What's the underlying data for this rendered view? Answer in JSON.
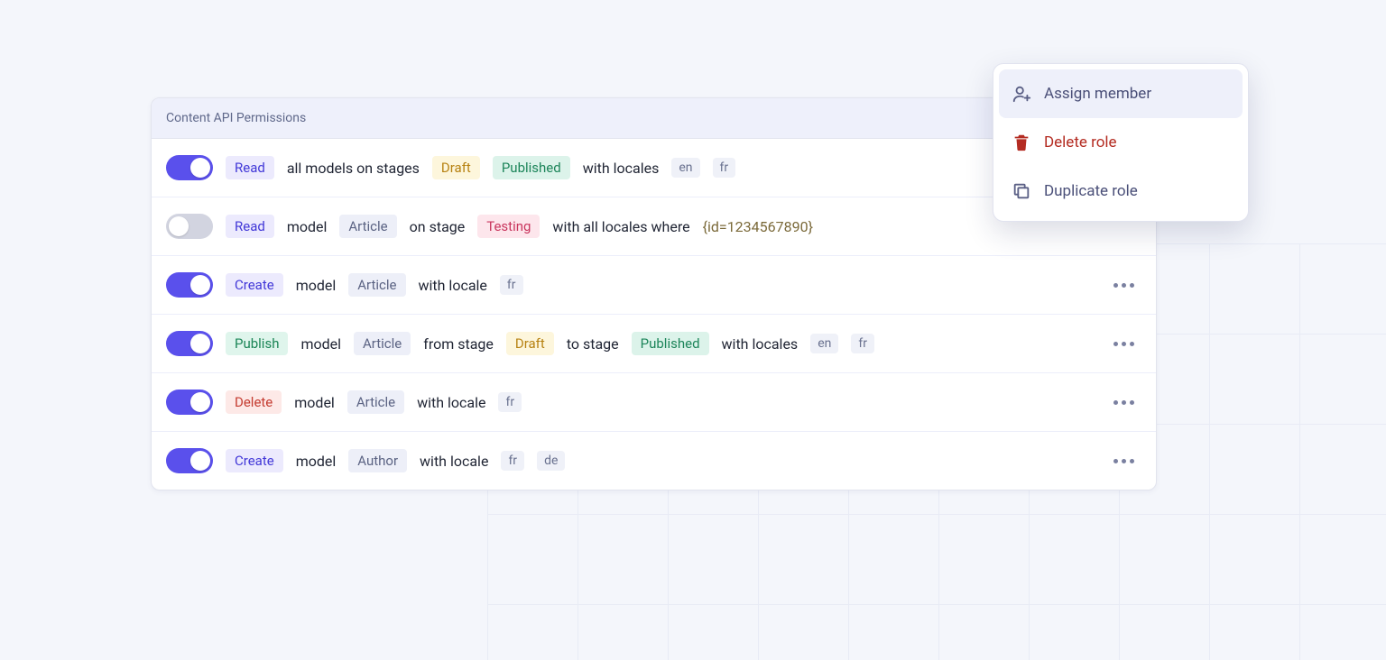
{
  "panel": {
    "title": "Content API Permissions"
  },
  "menu": {
    "items": [
      {
        "label": "Assign member",
        "kind": "assign"
      },
      {
        "label": "Delete role",
        "kind": "delete"
      },
      {
        "label": "Duplicate role",
        "kind": "duplicate"
      }
    ]
  },
  "rows": [
    {
      "enabled": true,
      "has_menu": false,
      "segments": [
        {
          "type": "action",
          "style": "indigo",
          "text": "Read"
        },
        {
          "type": "text",
          "text": "all models on stages"
        },
        {
          "type": "stage",
          "style": "draft",
          "text": "Draft"
        },
        {
          "type": "stage",
          "style": "pub",
          "text": "Published"
        },
        {
          "type": "text",
          "text": "with locales"
        },
        {
          "type": "locale",
          "text": "en"
        },
        {
          "type": "locale",
          "text": "fr"
        }
      ]
    },
    {
      "enabled": false,
      "has_menu": false,
      "segments": [
        {
          "type": "action",
          "style": "indigo",
          "text": "Read"
        },
        {
          "type": "text",
          "text": "model"
        },
        {
          "type": "model",
          "text": "Article"
        },
        {
          "type": "text",
          "text": "on stage"
        },
        {
          "type": "stage",
          "style": "test",
          "text": "Testing"
        },
        {
          "type": "text",
          "text": "with all locales where"
        },
        {
          "type": "condition",
          "text": "{id=1234567890}"
        }
      ]
    },
    {
      "enabled": true,
      "has_menu": true,
      "segments": [
        {
          "type": "action",
          "style": "indigo",
          "text": "Create"
        },
        {
          "type": "text",
          "text": "model"
        },
        {
          "type": "model",
          "text": "Article"
        },
        {
          "type": "text",
          "text": "with locale"
        },
        {
          "type": "locale",
          "text": "fr"
        }
      ]
    },
    {
      "enabled": true,
      "has_menu": true,
      "segments": [
        {
          "type": "action",
          "style": "green",
          "text": "Publish"
        },
        {
          "type": "text",
          "text": "model"
        },
        {
          "type": "model",
          "text": "Article"
        },
        {
          "type": "text",
          "text": "from stage"
        },
        {
          "type": "stage",
          "style": "draft",
          "text": "Draft"
        },
        {
          "type": "text",
          "text": "to stage"
        },
        {
          "type": "stage",
          "style": "pub",
          "text": "Published"
        },
        {
          "type": "text",
          "text": "with locales"
        },
        {
          "type": "locale",
          "text": "en"
        },
        {
          "type": "locale",
          "text": "fr"
        }
      ]
    },
    {
      "enabled": true,
      "has_menu": true,
      "segments": [
        {
          "type": "action",
          "style": "red",
          "text": "Delete"
        },
        {
          "type": "text",
          "text": "model"
        },
        {
          "type": "model",
          "text": "Article"
        },
        {
          "type": "text",
          "text": "with locale"
        },
        {
          "type": "locale",
          "text": "fr"
        }
      ]
    },
    {
      "enabled": true,
      "has_menu": true,
      "segments": [
        {
          "type": "action",
          "style": "indigo",
          "text": "Create"
        },
        {
          "type": "text",
          "text": "model"
        },
        {
          "type": "model",
          "text": "Author"
        },
        {
          "type": "text",
          "text": "with locale"
        },
        {
          "type": "locale",
          "text": "fr"
        },
        {
          "type": "locale",
          "text": "de"
        }
      ]
    }
  ]
}
